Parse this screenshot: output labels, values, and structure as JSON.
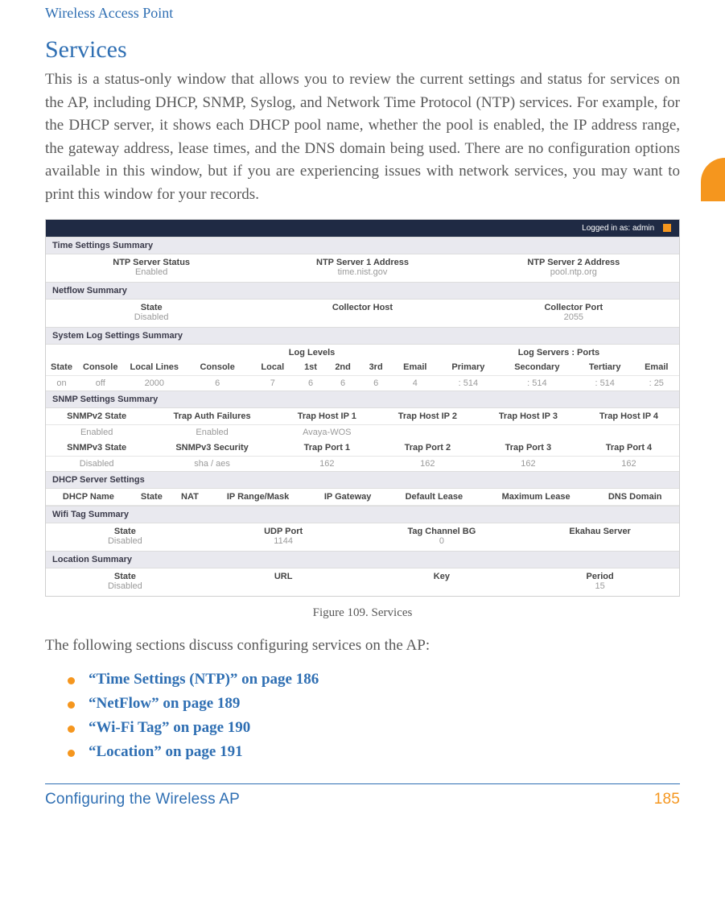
{
  "header": {
    "running": "Wireless Access Point"
  },
  "title": "Services",
  "paragraph1": "This is a status-only window that allows you to review the current settings and status for services on the AP, including DHCP, SNMP, Syslog, and Network Time Protocol (NTP) services. For example, for the DHCP server, it shows each DHCP pool name, whether the pool is enabled, the IP address range, the gateway address, lease times, and the DNS domain being used. There are no configuration options available in this window, but if you are experiencing issues with network services, you may want to print this window for your records.",
  "figure": {
    "topbar": "Logged in as: admin",
    "caption": "Figure 109. Services",
    "time": {
      "bar": "Time Settings Summary",
      "c1_lbl": "NTP Server Status",
      "c1_val": "Enabled",
      "c2_lbl": "NTP Server 1 Address",
      "c2_val": "time.nist.gov",
      "c3_lbl": "NTP Server 2 Address",
      "c3_val": "pool.ntp.org"
    },
    "netflow": {
      "bar": "Netflow Summary",
      "c1_lbl": "State",
      "c1_val": "Disabled",
      "c2_lbl": "Collector Host",
      "c2_val": "",
      "c3_lbl": "Collector Port",
      "c3_val": "2055"
    },
    "syslog": {
      "bar": "System Log Settings Summary",
      "grp_levels": "Log Levels",
      "grp_servers": "Log Servers : Ports",
      "h_state": "State",
      "h_console": "Console",
      "h_lines": "Local Lines",
      "h_lconsole": "Console",
      "h_local": "Local",
      "h_1st": "1st",
      "h_2nd": "2nd",
      "h_3rd": "3rd",
      "h_email": "Email",
      "h_primary": "Primary",
      "h_secondary": "Secondary",
      "h_tertiary": "Tertiary",
      "h_email2": "Email",
      "v_state": "on",
      "v_console": "off",
      "v_lines": "2000",
      "v_lconsole": "6",
      "v_local": "7",
      "v_1st": "6",
      "v_2nd": "6",
      "v_3rd": "6",
      "v_email": "4",
      "v_primary": ": 514",
      "v_secondary": ": 514",
      "v_tertiary": ": 514",
      "v_email2": ": 25"
    },
    "snmp": {
      "bar": "SNMP Settings Summary",
      "r1": {
        "h1": "SNMPv2 State",
        "h2": "Trap Auth Failures",
        "h3": "Trap Host IP 1",
        "h4": "Trap Host IP 2",
        "h5": "Trap Host IP 3",
        "h6": "Trap Host IP 4",
        "v1": "Enabled",
        "v2": "Enabled",
        "v3": "Avaya-WOS",
        "v4": "",
        "v5": "",
        "v6": ""
      },
      "r2": {
        "h1": "SNMPv3 State",
        "h2": "SNMPv3 Security",
        "h3": "Trap Port 1",
        "h4": "Trap Port 2",
        "h5": "Trap Port 3",
        "h6": "Trap Port 4",
        "v1": "Disabled",
        "v2": "sha / aes",
        "v3": "162",
        "v4": "162",
        "v5": "162",
        "v6": "162"
      }
    },
    "dhcp": {
      "bar": "DHCP Server Settings",
      "h1": "DHCP Name",
      "h2": "State",
      "h3": "NAT",
      "h4": "IP Range/Mask",
      "h5": "IP Gateway",
      "h6": "Default Lease",
      "h7": "Maximum Lease",
      "h8": "DNS Domain"
    },
    "wifi": {
      "bar": "Wifi Tag Summary",
      "c1_lbl": "State",
      "c1_val": "Disabled",
      "c2_lbl": "UDP Port",
      "c2_val": "1144",
      "c3_lbl": "Tag Channel BG",
      "c3_val": "0",
      "c4_lbl": "Ekahau Server",
      "c4_val": ""
    },
    "loc": {
      "bar": "Location Summary",
      "c1_lbl": "State",
      "c1_val": "Disabled",
      "c2_lbl": "URL",
      "c2_val": "",
      "c3_lbl": "Key",
      "c3_val": "",
      "c4_lbl": "Period",
      "c4_val": "15"
    }
  },
  "paragraph2": "The following sections discuss configuring services on the AP:",
  "links": {
    "l1": "“Time Settings (NTP)” on page 186",
    "l2": "“NetFlow” on page 189",
    "l3": "“Wi-Fi Tag” on page 190",
    "l4": "“Location” on page 191"
  },
  "footer": {
    "left": "Configuring the Wireless AP",
    "right": "185"
  }
}
